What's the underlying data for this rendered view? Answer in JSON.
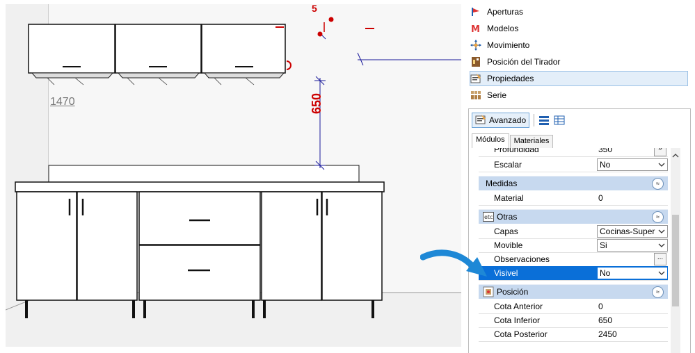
{
  "viewport": {
    "dimension_vertical": "650",
    "dimension_top": "5",
    "label_width": "1470"
  },
  "menu": {
    "items": [
      {
        "label": "Aperturas",
        "icon": "openings-icon"
      },
      {
        "label": "Modelos",
        "icon": "models-icon"
      },
      {
        "label": "Movimiento",
        "icon": "move-icon"
      },
      {
        "label": "Posición del Tirador",
        "icon": "handle-position-icon"
      },
      {
        "label": "Propiedades",
        "icon": "properties-icon",
        "selected": true
      },
      {
        "label": "Serie",
        "icon": "series-icon"
      }
    ]
  },
  "props": {
    "toolbar": {
      "advanced_label": "Avanzado"
    },
    "tabs": [
      {
        "label": "Módulos",
        "active": true
      },
      {
        "label": "Materiales",
        "active": false
      }
    ],
    "rows": {
      "profundidad": {
        "label": "Profundidad",
        "value": "350",
        "button": "»"
      },
      "escalar": {
        "label": "Escalar",
        "value": "No"
      },
      "medidas": {
        "label": "Medidas",
        "collapse": "≈"
      },
      "material": {
        "label": "Material",
        "value": "0"
      },
      "otras": {
        "label": "Otras",
        "icon_text": "etc",
        "collapse": "≈"
      },
      "capas": {
        "label": "Capas",
        "value": "Cocinas-Super"
      },
      "movible": {
        "label": "Movible",
        "value": "Si"
      },
      "observaciones": {
        "label": "Observaciones",
        "value": "",
        "button": "..."
      },
      "visivel": {
        "label": "Visivel",
        "value": "No"
      },
      "posicion": {
        "label": "Posición",
        "collapse": "≈"
      },
      "cota_anterior": {
        "label": "Cota Anterior",
        "value": "0"
      },
      "cota_inferior": {
        "label": "Cota Inferior",
        "value": "650"
      },
      "cota_posterior": {
        "label": "Cota Posterior",
        "value": "2450"
      }
    }
  },
  "colors": {
    "accent": "#0a6fd8",
    "category_bg": "#c7d9ef",
    "dimension_red": "#cc0000",
    "arrow_blue": "#1e88d6"
  }
}
